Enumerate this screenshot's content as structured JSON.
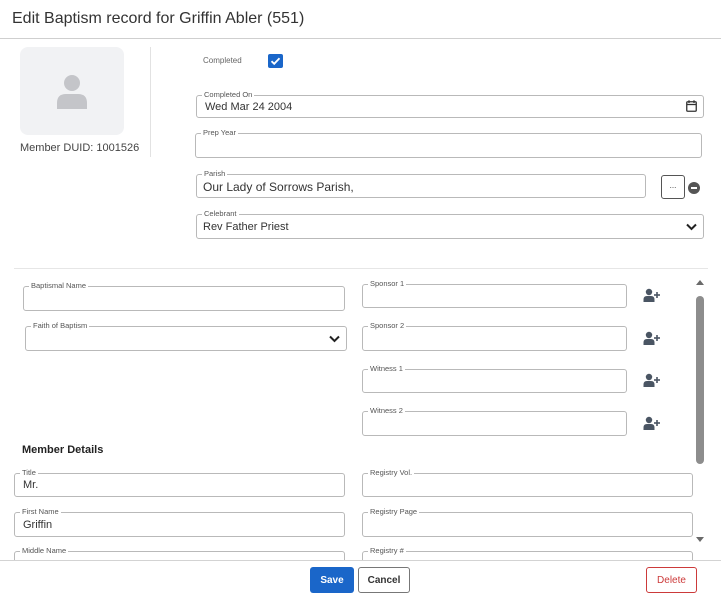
{
  "dialog": {
    "title": "Edit Baptism record for Griffin Abler (551)"
  },
  "member": {
    "duid_label": "Member DUID: 1001526"
  },
  "record": {
    "completed_label": "Completed",
    "completed_checked": true,
    "completed_on": {
      "label": "Completed On",
      "value": "Wed Mar 24 2004"
    },
    "prep_year": {
      "label": "Prep Year",
      "value": ""
    },
    "parish": {
      "label": "Parish",
      "value": "Our Lady of Sorrows Parish,",
      "browse_label": "..."
    },
    "celebrant": {
      "label": "Celebrant",
      "value": "Rev Father Priest"
    }
  },
  "baptism": {
    "baptismal_name": {
      "label": "Baptismal Name",
      "value": ""
    },
    "faith_of_baptism": {
      "label": "Faith of Baptism",
      "value": ""
    },
    "sponsor1": {
      "label": "Sponsor 1",
      "value": ""
    },
    "sponsor2": {
      "label": "Sponsor 2",
      "value": ""
    },
    "witness1": {
      "label": "Witness 1",
      "value": ""
    },
    "witness2": {
      "label": "Witness 2",
      "value": ""
    }
  },
  "member_details": {
    "section_title": "Member Details",
    "title": {
      "label": "Title",
      "value": "Mr."
    },
    "first_name": {
      "label": "First Name",
      "value": "Griffin"
    },
    "middle_name": {
      "label": "Middle Name",
      "value": ""
    },
    "registry_vol": {
      "label": "Registry Vol.",
      "value": ""
    },
    "registry_page": {
      "label": "Registry Page",
      "value": ""
    },
    "registry_num": {
      "label": "Registry #",
      "value": ""
    }
  },
  "footer": {
    "save_label": "Save",
    "cancel_label": "Cancel",
    "delete_label": "Delete"
  },
  "colors": {
    "primary": "#1a66c9",
    "danger": "#cc3a3a"
  }
}
